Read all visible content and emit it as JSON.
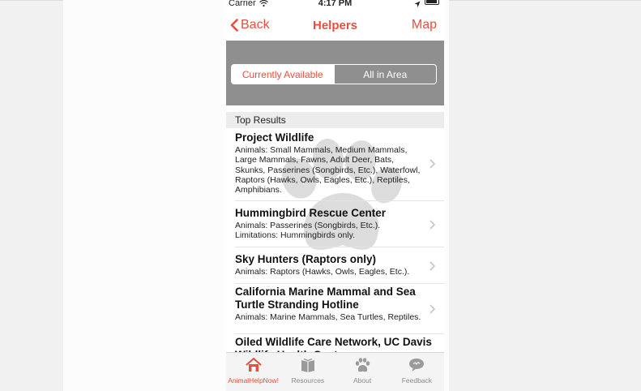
{
  "status_bar": {
    "carrier": "Carrier",
    "time": "4:17 PM"
  },
  "nav": {
    "back_label": "Back",
    "title": "Helpers",
    "map_label": "Map"
  },
  "segmented": {
    "options": [
      "Currently Available",
      "All in Area"
    ],
    "selected": "Currently Available"
  },
  "section": {
    "header": "Top Results"
  },
  "results": [
    {
      "name": "Project Wildlife",
      "desc": "Animals: Small Mammals, Medium Mammals, Large Mammals, Fawns, Adult Deer, Bats, Skunks, Passerines (Songbirds, Etc.), Waterfowl, Raptors (Hawks, Owls, Eagles, Etc.), Reptiles, Amphibians."
    },
    {
      "name": "Hummingbird Rescue Center",
      "desc": "Animals: Passerines (Songbirds, Etc.). Limitations: Hummingbirds only."
    },
    {
      "name": "Sky Hunters (Raptors only)",
      "desc": "Animals: Raptors (Hawks, Owls, Eagles, Etc.)."
    },
    {
      "name": "California Marine Mammal and Sea Turtle Stranding Hotline",
      "desc": "Animals: Marine Mammals, Sea Turtles, Reptiles."
    },
    {
      "name": "Oiled Wildlife Care Network, UC Davis Wildlife Health Center",
      "desc": ""
    }
  ],
  "tabs": [
    {
      "label": "AnimalHelpNow!",
      "icon": "home-icon",
      "active": true
    },
    {
      "label": "Resources",
      "icon": "book-icon",
      "active": false
    },
    {
      "label": "About",
      "icon": "paw-icon",
      "active": false
    },
    {
      "label": "Feedback",
      "icon": "speech-bubble-icon",
      "active": false
    }
  ],
  "colors": {
    "accent": "#e3503e",
    "segment_background": "#8f8f8f",
    "inactive_tab": "#8a8a8a"
  }
}
